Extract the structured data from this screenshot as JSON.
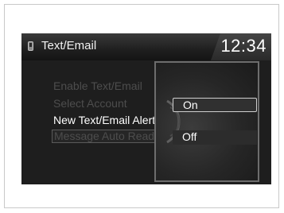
{
  "header": {
    "title": "Text/Email",
    "clock": "12:34"
  },
  "menu": {
    "items": [
      {
        "label": "Enable Text/Email",
        "state": "disabled"
      },
      {
        "label": "Select Account",
        "state": "disabled"
      },
      {
        "label": "New Text/Email Alert",
        "state": "selected"
      },
      {
        "label": "Message Auto Reading",
        "state": "disabled"
      }
    ]
  },
  "popup": {
    "options": [
      {
        "label": "On",
        "selected": true
      },
      {
        "label": "Off",
        "selected": false
      }
    ]
  },
  "icons": {
    "header": "phone-icon",
    "popup": "selector-knob-icon"
  }
}
